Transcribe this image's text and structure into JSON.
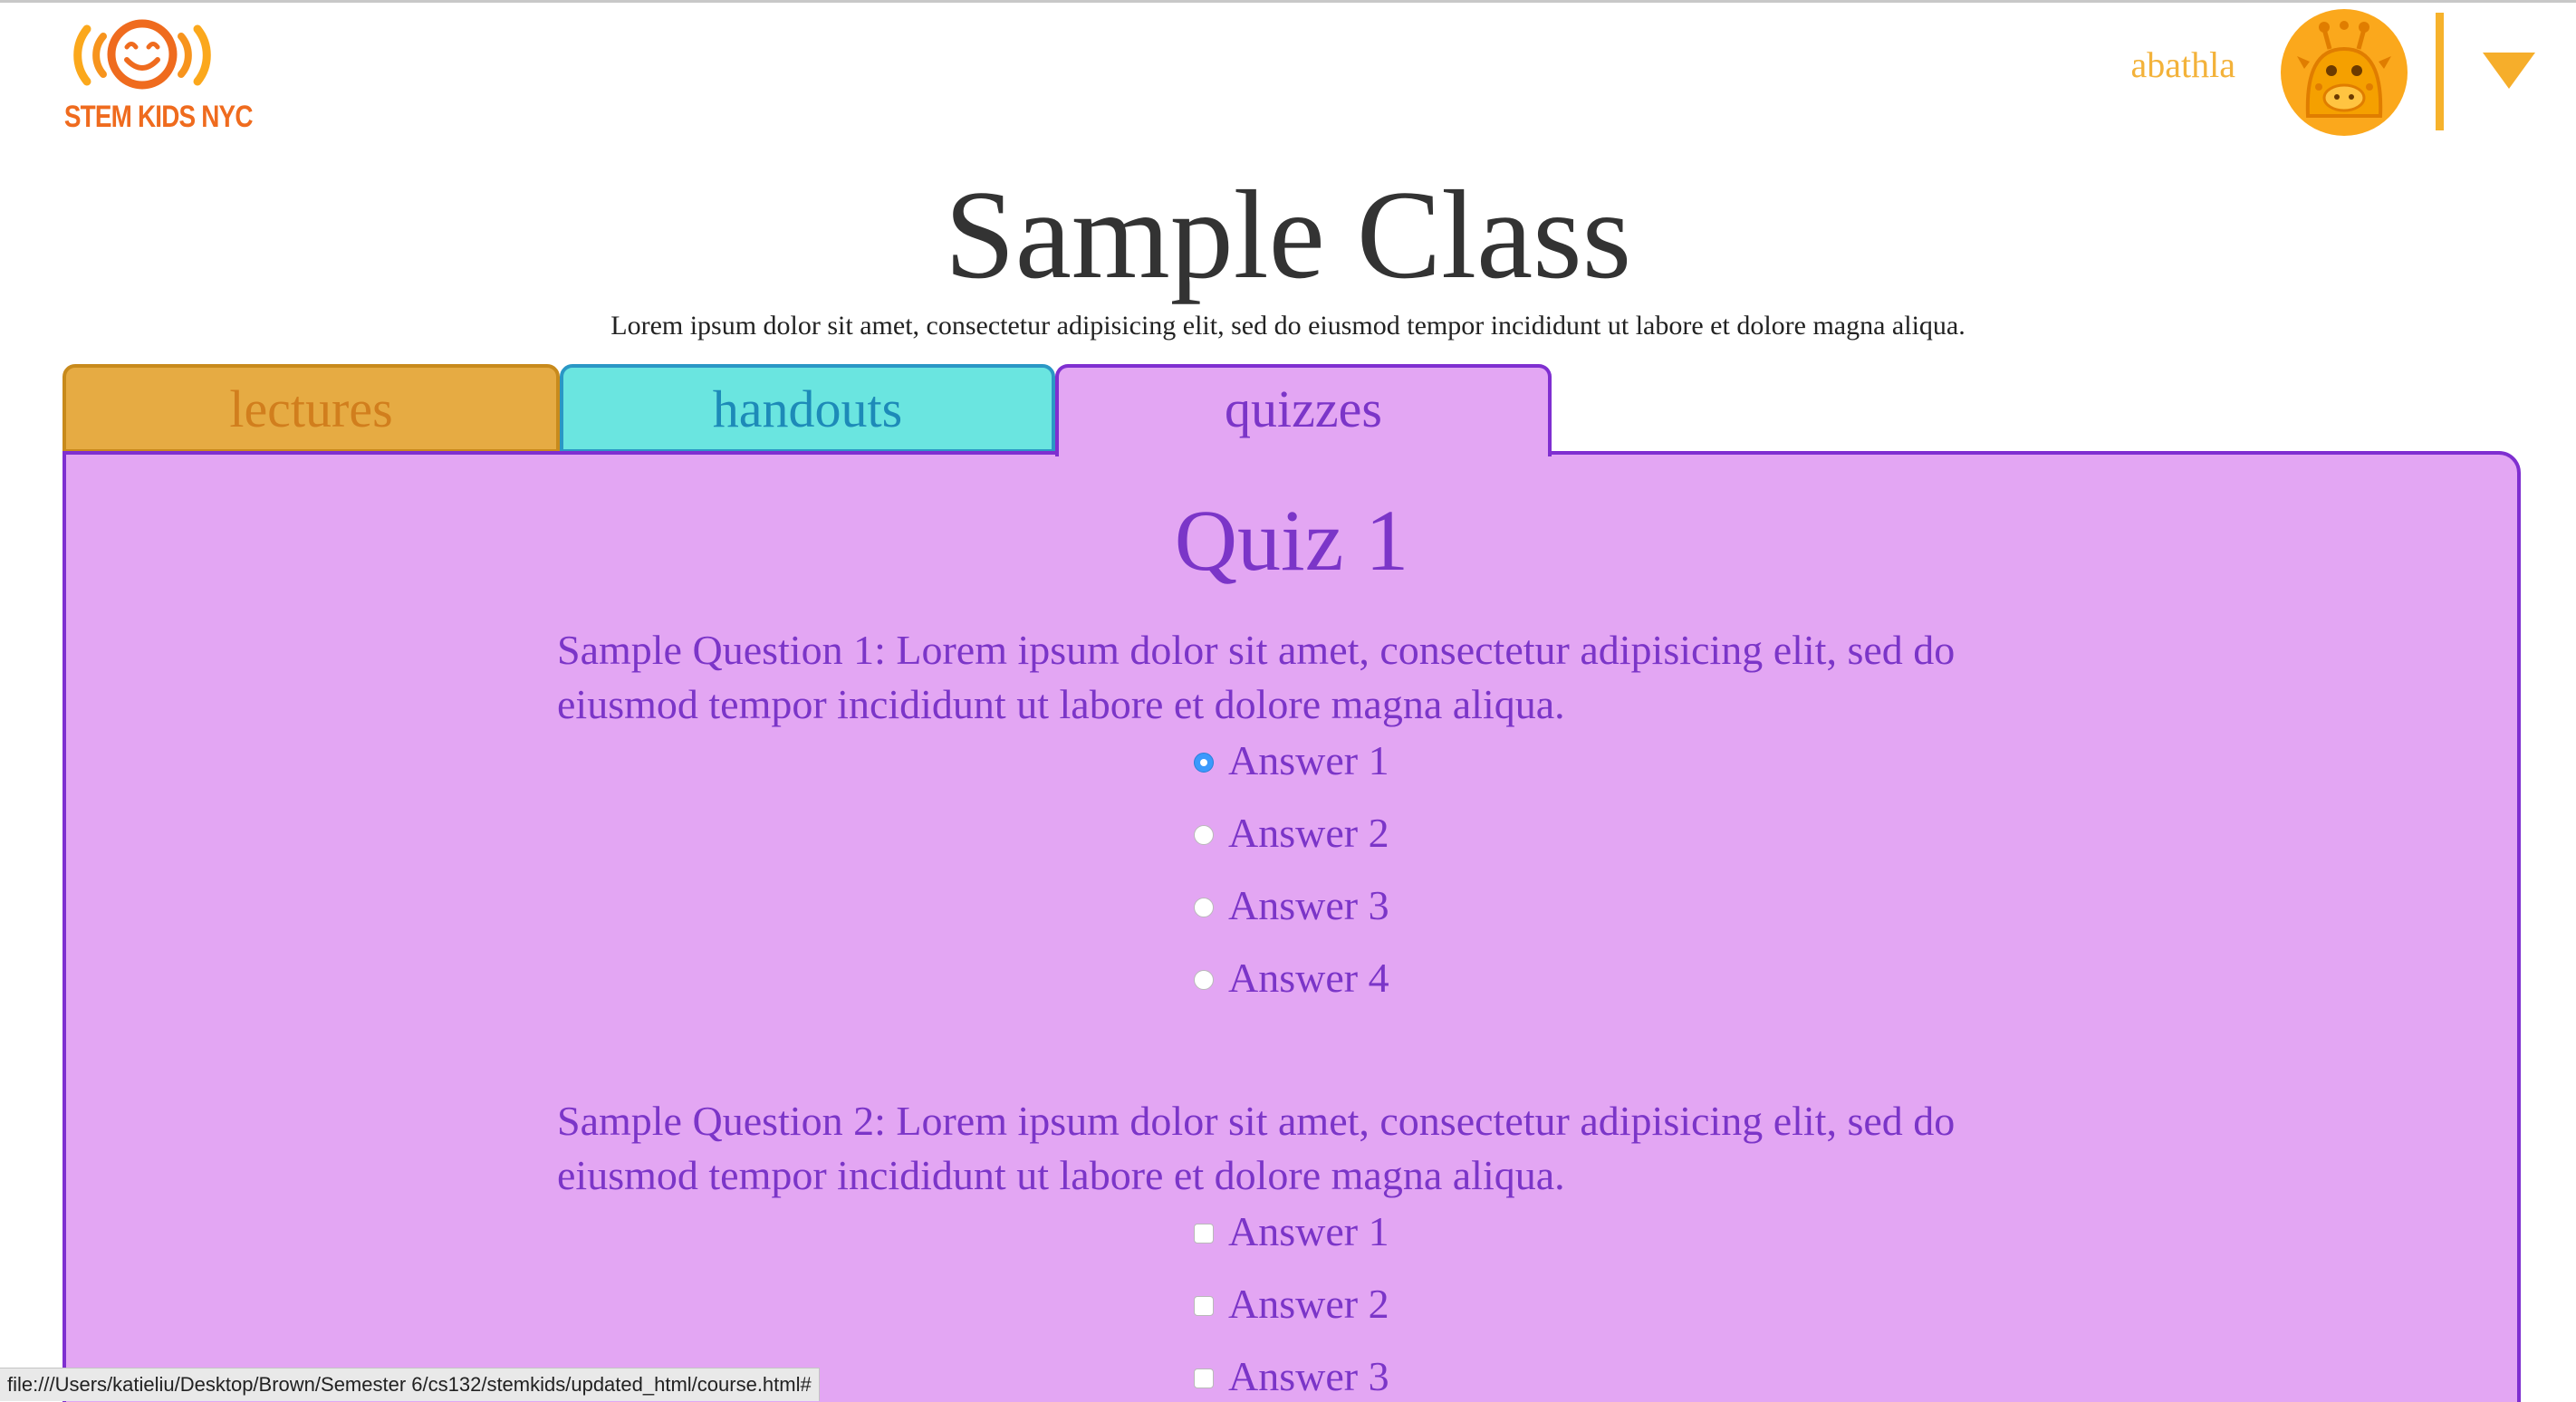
{
  "brand": {
    "logo_text": "STEM KIDS NYC",
    "colors": {
      "orange": "#ef6b1e",
      "gold": "#fba81c"
    }
  },
  "header": {
    "username": "abathla",
    "avatar_icon": "giraffe-avatar-icon",
    "menu_icon": "triangle-down-icon"
  },
  "course": {
    "title": "Sample Class",
    "description": "Lorem ipsum dolor sit amet, consectetur adipisicing elit, sed do eiusmod tempor incididunt ut labore et dolore magna aliqua."
  },
  "tabs": [
    {
      "label": "lectures",
      "color": "#e6ab43",
      "active": false
    },
    {
      "label": "handouts",
      "color": "#6ae5e0",
      "active": false
    },
    {
      "label": "quizzes",
      "color": "#e3a6f3",
      "active": true
    }
  ],
  "quiz": {
    "title": "Quiz 1",
    "questions": [
      {
        "text": "Sample Question 1: Lorem ipsum dolor sit amet, consectetur adipisicing elit, sed do eiusmod tempor incididunt ut labore et dolore magna aliqua.",
        "type": "radio",
        "answers": [
          {
            "label": "Answer 1",
            "selected": true
          },
          {
            "label": "Answer 2",
            "selected": false
          },
          {
            "label": "Answer 3",
            "selected": false
          },
          {
            "label": "Answer 4",
            "selected": false
          }
        ]
      },
      {
        "text": "Sample Question 2: Lorem ipsum dolor sit amet, consectetur adipisicing elit, sed do eiusmod tempor incididunt ut labore et dolore magna aliqua.",
        "type": "checkbox",
        "answers": [
          {
            "label": "Answer 1",
            "selected": false
          },
          {
            "label": "Answer 2",
            "selected": false
          },
          {
            "label": "Answer 3",
            "selected": false
          }
        ]
      }
    ]
  },
  "status_bar": {
    "url": "file:///Users/katieliu/Desktop/Brown/Semester 6/cs132/stemkids/updated_html/course.html#"
  }
}
